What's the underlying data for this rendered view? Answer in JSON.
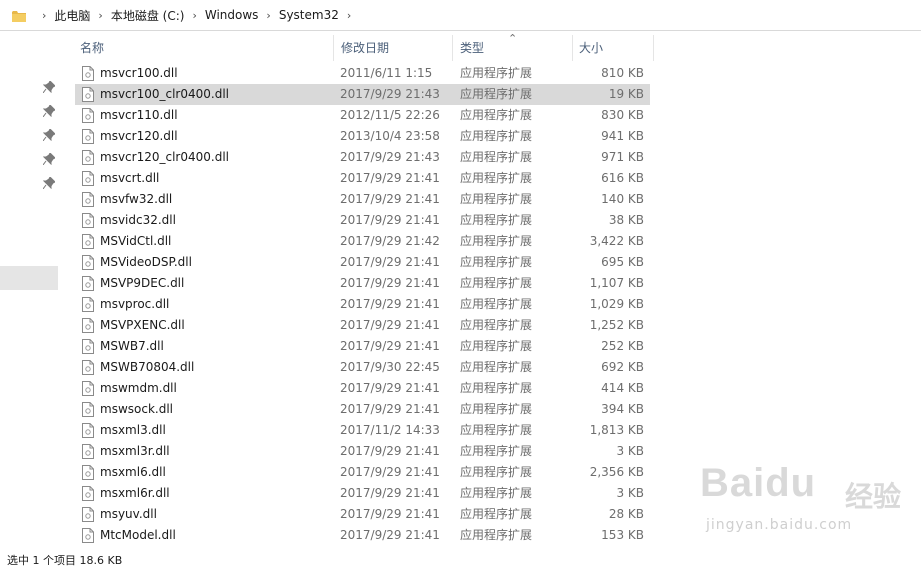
{
  "breadcrumb": [
    "此电脑",
    "本地磁盘 (C:)",
    "Windows",
    "System32"
  ],
  "columns": {
    "name": "名称",
    "date": "修改日期",
    "type": "类型",
    "size": "大小"
  },
  "files": [
    {
      "name": "msvcr100.dll",
      "date": "2011/6/11 1:15",
      "type": "应用程序扩展",
      "size": "810 KB"
    },
    {
      "name": "msvcr100_clr0400.dll",
      "date": "2017/9/29 21:43",
      "type": "应用程序扩展",
      "size": "19 KB",
      "selected": true
    },
    {
      "name": "msvcr110.dll",
      "date": "2012/11/5 22:26",
      "type": "应用程序扩展",
      "size": "830 KB"
    },
    {
      "name": "msvcr120.dll",
      "date": "2013/10/4 23:58",
      "type": "应用程序扩展",
      "size": "941 KB"
    },
    {
      "name": "msvcr120_clr0400.dll",
      "date": "2017/9/29 21:43",
      "type": "应用程序扩展",
      "size": "971 KB"
    },
    {
      "name": "msvcrt.dll",
      "date": "2017/9/29 21:41",
      "type": "应用程序扩展",
      "size": "616 KB"
    },
    {
      "name": "msvfw32.dll",
      "date": "2017/9/29 21:41",
      "type": "应用程序扩展",
      "size": "140 KB"
    },
    {
      "name": "msvidc32.dll",
      "date": "2017/9/29 21:41",
      "type": "应用程序扩展",
      "size": "38 KB"
    },
    {
      "name": "MSVidCtl.dll",
      "date": "2017/9/29 21:42",
      "type": "应用程序扩展",
      "size": "3,422 KB"
    },
    {
      "name": "MSVideoDSP.dll",
      "date": "2017/9/29 21:41",
      "type": "应用程序扩展",
      "size": "695 KB"
    },
    {
      "name": "MSVP9DEC.dll",
      "date": "2017/9/29 21:41",
      "type": "应用程序扩展",
      "size": "1,107 KB"
    },
    {
      "name": "msvproc.dll",
      "date": "2017/9/29 21:41",
      "type": "应用程序扩展",
      "size": "1,029 KB"
    },
    {
      "name": "MSVPXENC.dll",
      "date": "2017/9/29 21:41",
      "type": "应用程序扩展",
      "size": "1,252 KB"
    },
    {
      "name": "MSWB7.dll",
      "date": "2017/9/29 21:41",
      "type": "应用程序扩展",
      "size": "252 KB"
    },
    {
      "name": "MSWB70804.dll",
      "date": "2017/9/30 22:45",
      "type": "应用程序扩展",
      "size": "692 KB"
    },
    {
      "name": "mswmdm.dll",
      "date": "2017/9/29 21:41",
      "type": "应用程序扩展",
      "size": "414 KB"
    },
    {
      "name": "mswsock.dll",
      "date": "2017/9/29 21:41",
      "type": "应用程序扩展",
      "size": "394 KB"
    },
    {
      "name": "msxml3.dll",
      "date": "2017/11/2 14:33",
      "type": "应用程序扩展",
      "size": "1,813 KB"
    },
    {
      "name": "msxml3r.dll",
      "date": "2017/9/29 21:41",
      "type": "应用程序扩展",
      "size": "3 KB"
    },
    {
      "name": "msxml6.dll",
      "date": "2017/9/29 21:41",
      "type": "应用程序扩展",
      "size": "2,356 KB"
    },
    {
      "name": "msxml6r.dll",
      "date": "2017/9/29 21:41",
      "type": "应用程序扩展",
      "size": "3 KB"
    },
    {
      "name": "msyuv.dll",
      "date": "2017/9/29 21:41",
      "type": "应用程序扩展",
      "size": "28 KB"
    },
    {
      "name": "MtcModel.dll",
      "date": "2017/9/29 21:41",
      "type": "应用程序扩展",
      "size": "153 KB"
    }
  ],
  "status": "选中 1 个项目 18.6 KB",
  "watermark": {
    "logo": "Baidu",
    "cn": "经验",
    "url": "jingyan.baidu.com"
  },
  "colors": {
    "selected_row": "#d9d9d9",
    "header_text": "#4c607a",
    "folder": "#e8b84a"
  }
}
